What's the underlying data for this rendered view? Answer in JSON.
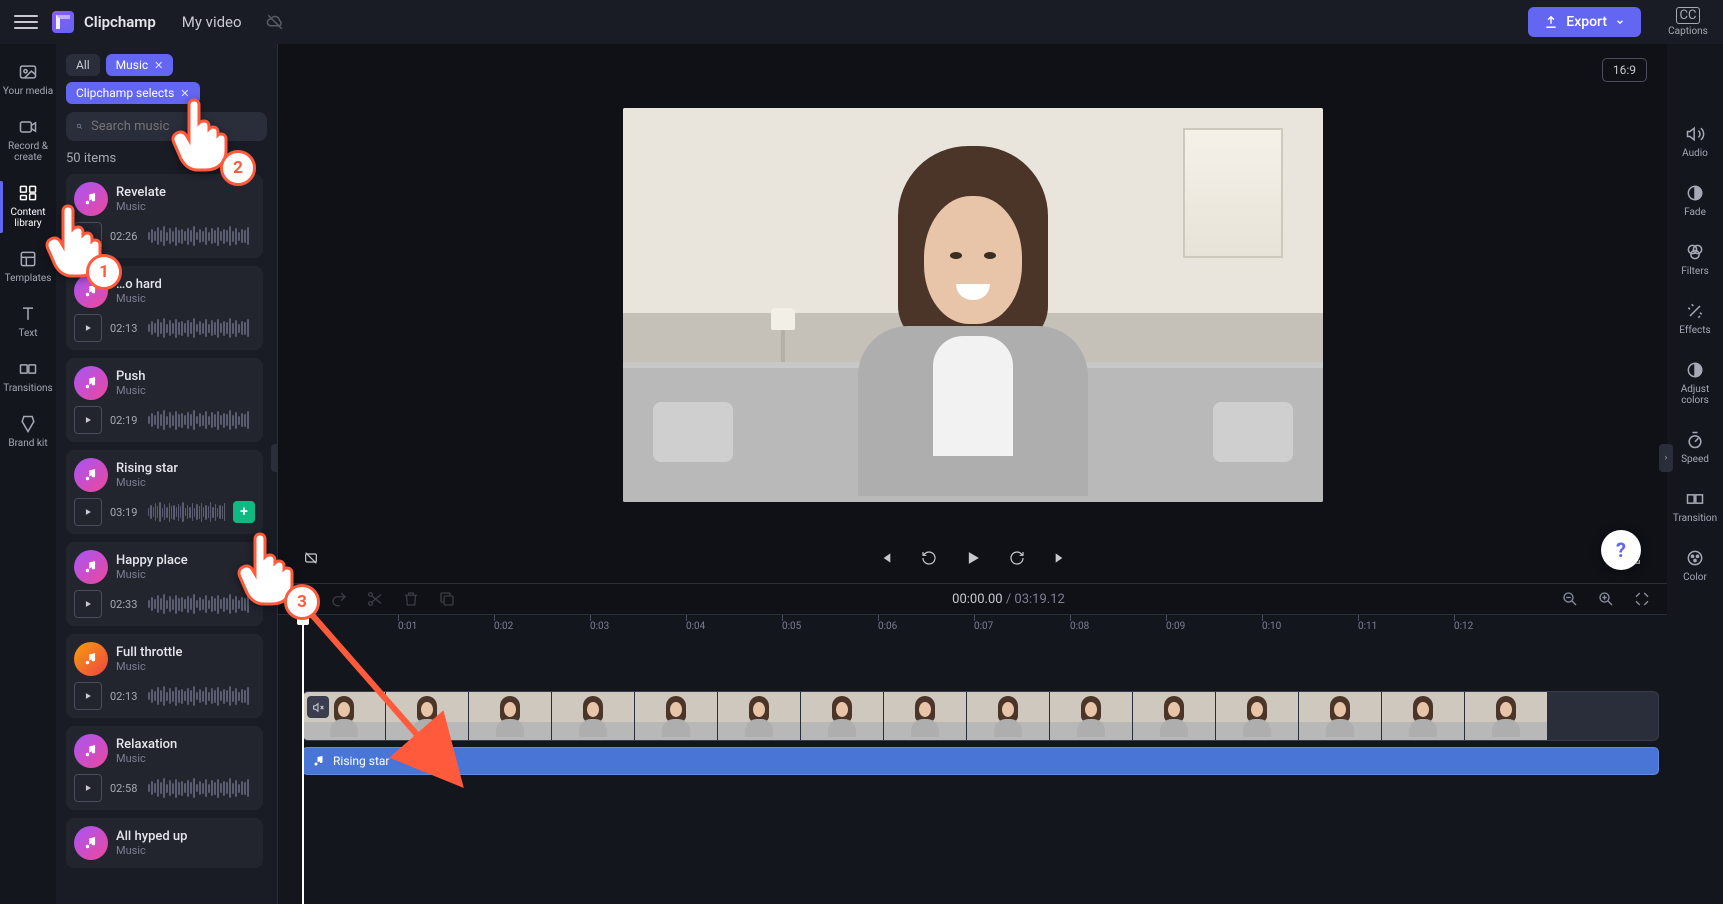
{
  "app": {
    "name": "Clipchamp",
    "videoTitle": "My video"
  },
  "export": {
    "label": "Export"
  },
  "aspect": {
    "label": "16:9"
  },
  "captions": {
    "label": "Captions"
  },
  "leftnav": [
    {
      "id": "your-media",
      "label": "Your media"
    },
    {
      "id": "record-create",
      "label": "Record & create"
    },
    {
      "id": "content-library",
      "label": "Content library"
    },
    {
      "id": "templates",
      "label": "Templates"
    },
    {
      "id": "text",
      "label": "Text"
    },
    {
      "id": "transitions",
      "label": "Transitions"
    },
    {
      "id": "brand-kit",
      "label": "Brand kit"
    }
  ],
  "rightnav": [
    {
      "id": "audio",
      "label": "Audio"
    },
    {
      "id": "fade",
      "label": "Fade"
    },
    {
      "id": "filters",
      "label": "Filters"
    },
    {
      "id": "effects",
      "label": "Effects"
    },
    {
      "id": "adjust-colors",
      "label": "Adjust colors"
    },
    {
      "id": "speed",
      "label": "Speed"
    },
    {
      "id": "transition",
      "label": "Transition"
    },
    {
      "id": "color",
      "label": "Color"
    }
  ],
  "chips": {
    "all": "All",
    "music": "Music",
    "selects": "Clipchamp selects"
  },
  "search": {
    "placeholder": "Search music"
  },
  "count": "50 items",
  "tracks": [
    {
      "title": "Revelate",
      "sub": "Music",
      "dur": "02:26"
    },
    {
      "title": "…o hard",
      "sub": "Music",
      "dur": "02:13"
    },
    {
      "title": "Push",
      "sub": "Music",
      "dur": "02:19"
    },
    {
      "title": "Rising star",
      "sub": "Music",
      "dur": "03:19"
    },
    {
      "title": "Happy place",
      "sub": "Music",
      "dur": "02:33"
    },
    {
      "title": "Full throttle",
      "sub": "Music",
      "dur": "02:13"
    },
    {
      "title": "Relaxation",
      "sub": "Music",
      "dur": "02:58"
    },
    {
      "title": "All hyped up",
      "sub": "Music",
      "dur": ""
    }
  ],
  "time": {
    "current": "00:00.00",
    "total": "03:19.12"
  },
  "ruler": [
    "0:01",
    "0:02",
    "0:03",
    "0:04",
    "0:05",
    "0:06",
    "0:07",
    "0:08",
    "0:09",
    "0:10",
    "0:11",
    "0:12"
  ],
  "audioClip": {
    "title": "Rising star"
  },
  "annotations": {
    "n1": "1",
    "n2": "2",
    "n3": "3"
  }
}
